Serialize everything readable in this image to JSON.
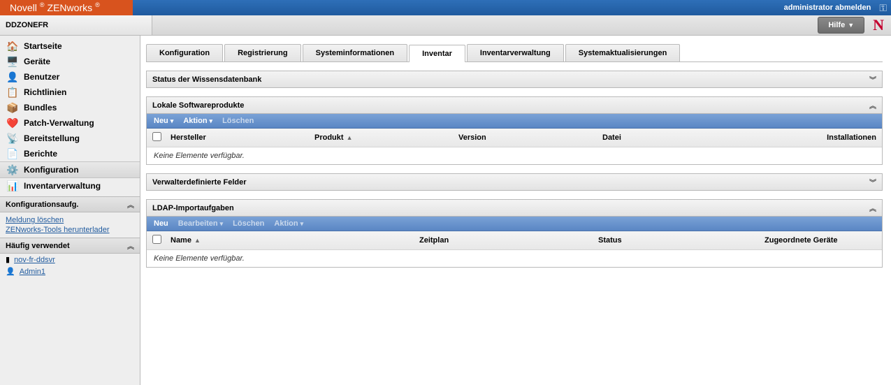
{
  "brand": {
    "name1": "Novell",
    "name2": "ZENworks"
  },
  "header": {
    "logout": "administrator abmelden",
    "zone": "DDZONEFR",
    "help": "Hilfe"
  },
  "sidebar": {
    "items": [
      {
        "label": "Startseite"
      },
      {
        "label": "Geräte"
      },
      {
        "label": "Benutzer"
      },
      {
        "label": "Richtlinien"
      },
      {
        "label": "Bundles"
      },
      {
        "label": "Patch-Verwaltung"
      },
      {
        "label": "Bereitstellung"
      },
      {
        "label": "Berichte"
      },
      {
        "label": "Konfiguration"
      },
      {
        "label": "Inventarverwaltung"
      }
    ],
    "tasks_head": "Konfigurationsaufg.",
    "tasks": [
      "Meldung löschen",
      "ZENworks-Tools herunterlader"
    ],
    "freq_head": "Häufig verwendet",
    "freq": [
      "nov-fr-ddsvr",
      "Admin1"
    ]
  },
  "tabs": [
    "Konfiguration",
    "Registrierung",
    "Systeminformationen",
    "Inventar",
    "Inventarverwaltung",
    "Systemaktualisierungen"
  ],
  "active_tab": 3,
  "panel_kb": {
    "title": "Status der Wissensdatenbank"
  },
  "panel_sw": {
    "title": "Lokale Softwareprodukte",
    "actions": {
      "neu": "Neu",
      "aktion": "Aktion",
      "loeschen": "Löschen"
    },
    "cols": {
      "hersteller": "Hersteller",
      "produkt": "Produkt",
      "version": "Version",
      "datei": "Datei",
      "install": "Installationen"
    },
    "empty": "Keine Elemente verfügbar."
  },
  "panel_fields": {
    "title": "Verwalterdefinierte Felder"
  },
  "panel_ldap": {
    "title": "LDAP-Importaufgaben",
    "actions": {
      "neu": "Neu",
      "bearbeiten": "Bearbeiten",
      "loeschen": "Löschen",
      "aktion": "Aktion"
    },
    "cols": {
      "name": "Name",
      "zeitplan": "Zeitplan",
      "status": "Status",
      "geraete": "Zugeordnete Geräte"
    },
    "empty": "Keine Elemente verfügbar."
  }
}
